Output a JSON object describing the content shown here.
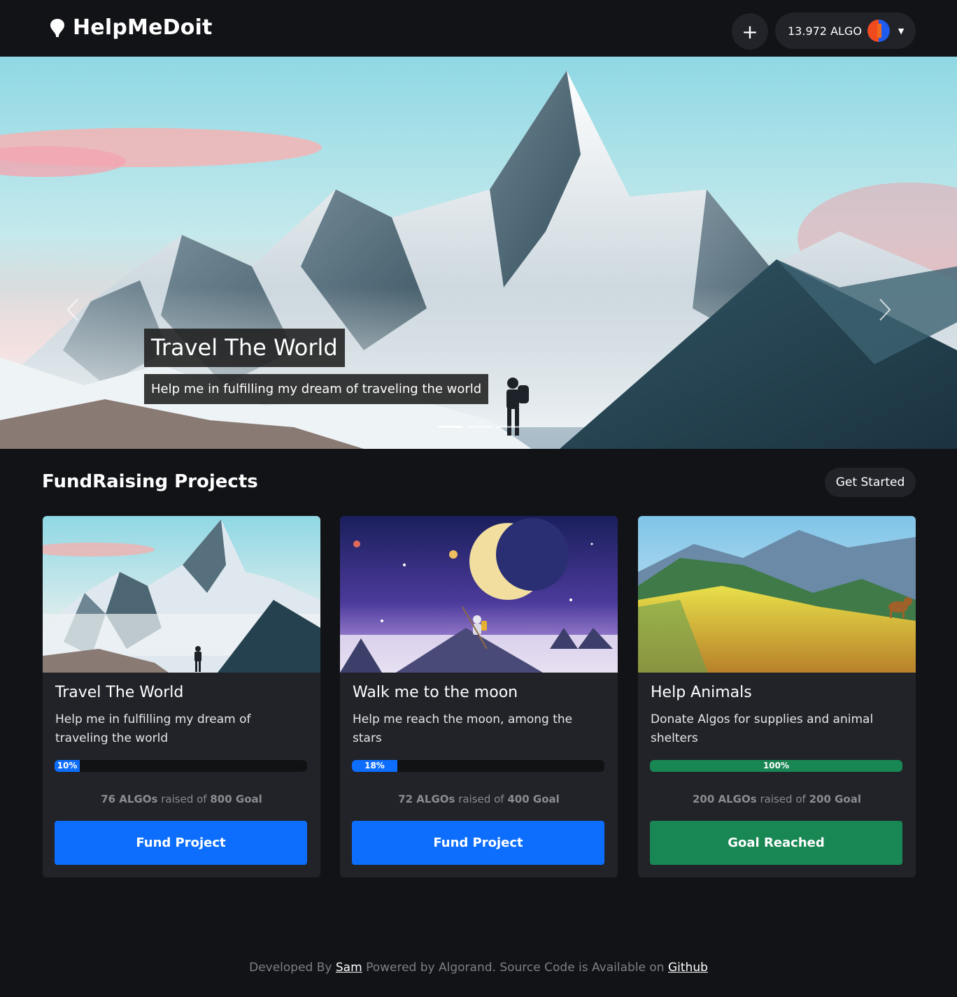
{
  "navbar": {
    "brand": "HelpMeDoit",
    "add_label": "+",
    "wallet_balance": "13.972 ALGO",
    "icons": {
      "brand": "pin-icon",
      "add": "plus-icon",
      "caret": "caret-down-icon"
    }
  },
  "hero": {
    "title": "Travel The World",
    "subtitle": "Help me in fulfilling my dream of traveling the world",
    "slides_count": 3,
    "active_slide": 1,
    "icons": {
      "prev": "chevron-left-icon",
      "next": "chevron-right-icon"
    }
  },
  "section": {
    "title": "FundRaising Projects",
    "get_started": "Get Started"
  },
  "projects": [
    {
      "title": "Travel The World",
      "description": "Help me in fulfilling my dream of traveling the world",
      "progress_percent": 10,
      "progress_label": "10%",
      "raised_amount": "76 ALGOs",
      "raised_mid": "raised of",
      "goal": "800 Goal",
      "button": "Fund Project",
      "bar_color": "#0d6efd",
      "button_color": "#0d6efd"
    },
    {
      "title": "Walk me to the moon",
      "description": "Help me reach the moon, among the stars",
      "progress_percent": 18,
      "progress_label": "18%",
      "raised_amount": "72 ALGOs",
      "raised_mid": "raised of",
      "goal": "400 Goal",
      "button": "Fund Project",
      "bar_color": "#0d6efd",
      "button_color": "#0d6efd"
    },
    {
      "title": "Help Animals",
      "description": "Donate Algos for supplies and animal shelters",
      "progress_percent": 100,
      "progress_label": "100%",
      "raised_amount": "200 ALGOs",
      "raised_mid": "raised of",
      "goal": "200 Goal",
      "button": "Goal Reached",
      "bar_color": "#198754",
      "button_color": "#198754"
    }
  ],
  "footer": {
    "prefix": "Developed By",
    "author": "Sam",
    "middle": "Powered by Algorand. Source Code is Available on",
    "link": "Github"
  },
  "colors": {
    "background": "#121317",
    "surface": "#212329",
    "primary": "#0d6efd",
    "success": "#198754"
  }
}
